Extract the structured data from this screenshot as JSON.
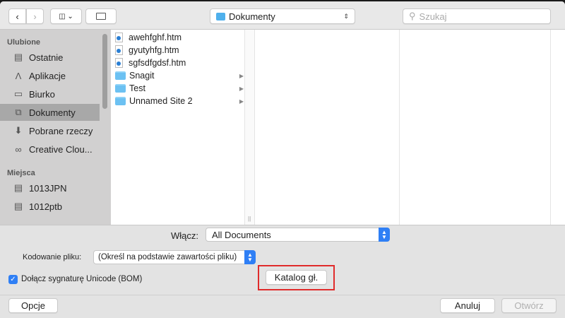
{
  "toolbar": {
    "location": "Dokumenty",
    "search_placeholder": "Szukaj"
  },
  "sidebar": {
    "favorites_header": "Ulubione",
    "favorites": [
      {
        "label": "Ostatnie",
        "icon": "recents-icon"
      },
      {
        "label": "Aplikacje",
        "icon": "applications-icon"
      },
      {
        "label": "Biurko",
        "icon": "desktop-icon"
      },
      {
        "label": "Dokumenty",
        "icon": "documents-icon",
        "selected": true
      },
      {
        "label": "Pobrane rzeczy",
        "icon": "downloads-icon"
      },
      {
        "label": "Creative Clou...",
        "icon": "creative-cloud-icon"
      }
    ],
    "places_header": "Miejsca",
    "places": [
      {
        "label": "1013JPN",
        "icon": "disk-icon"
      },
      {
        "label": "1012ptb",
        "icon": "disk-icon"
      }
    ]
  },
  "files": [
    {
      "name": "awehfghf.htm",
      "type": "file"
    },
    {
      "name": "gyutyhfg.htm",
      "type": "file"
    },
    {
      "name": "sgfsdfgdsf.htm",
      "type": "file"
    },
    {
      "name": "Snagit",
      "type": "folder"
    },
    {
      "name": "Test",
      "type": "folder"
    },
    {
      "name": "Unnamed Site 2",
      "type": "folder"
    }
  ],
  "options": {
    "enable_label": "Włącz:",
    "enable_value": "All Documents",
    "encoding_label": "Kodowanie pliku:",
    "encoding_value": "(Określ na podstawie zawartości pliku)",
    "bom_label": "Dołącz sygnaturę Unicode (BOM)",
    "bom_checked": true,
    "home_button": "Katalog gł."
  },
  "footer": {
    "options_button": "Opcje",
    "cancel_button": "Anuluj",
    "open_button": "Otwórz"
  },
  "colors": {
    "accent": "#2f7ff5",
    "highlight_box": "#e02b2b",
    "folder": "#6cc1f2"
  }
}
